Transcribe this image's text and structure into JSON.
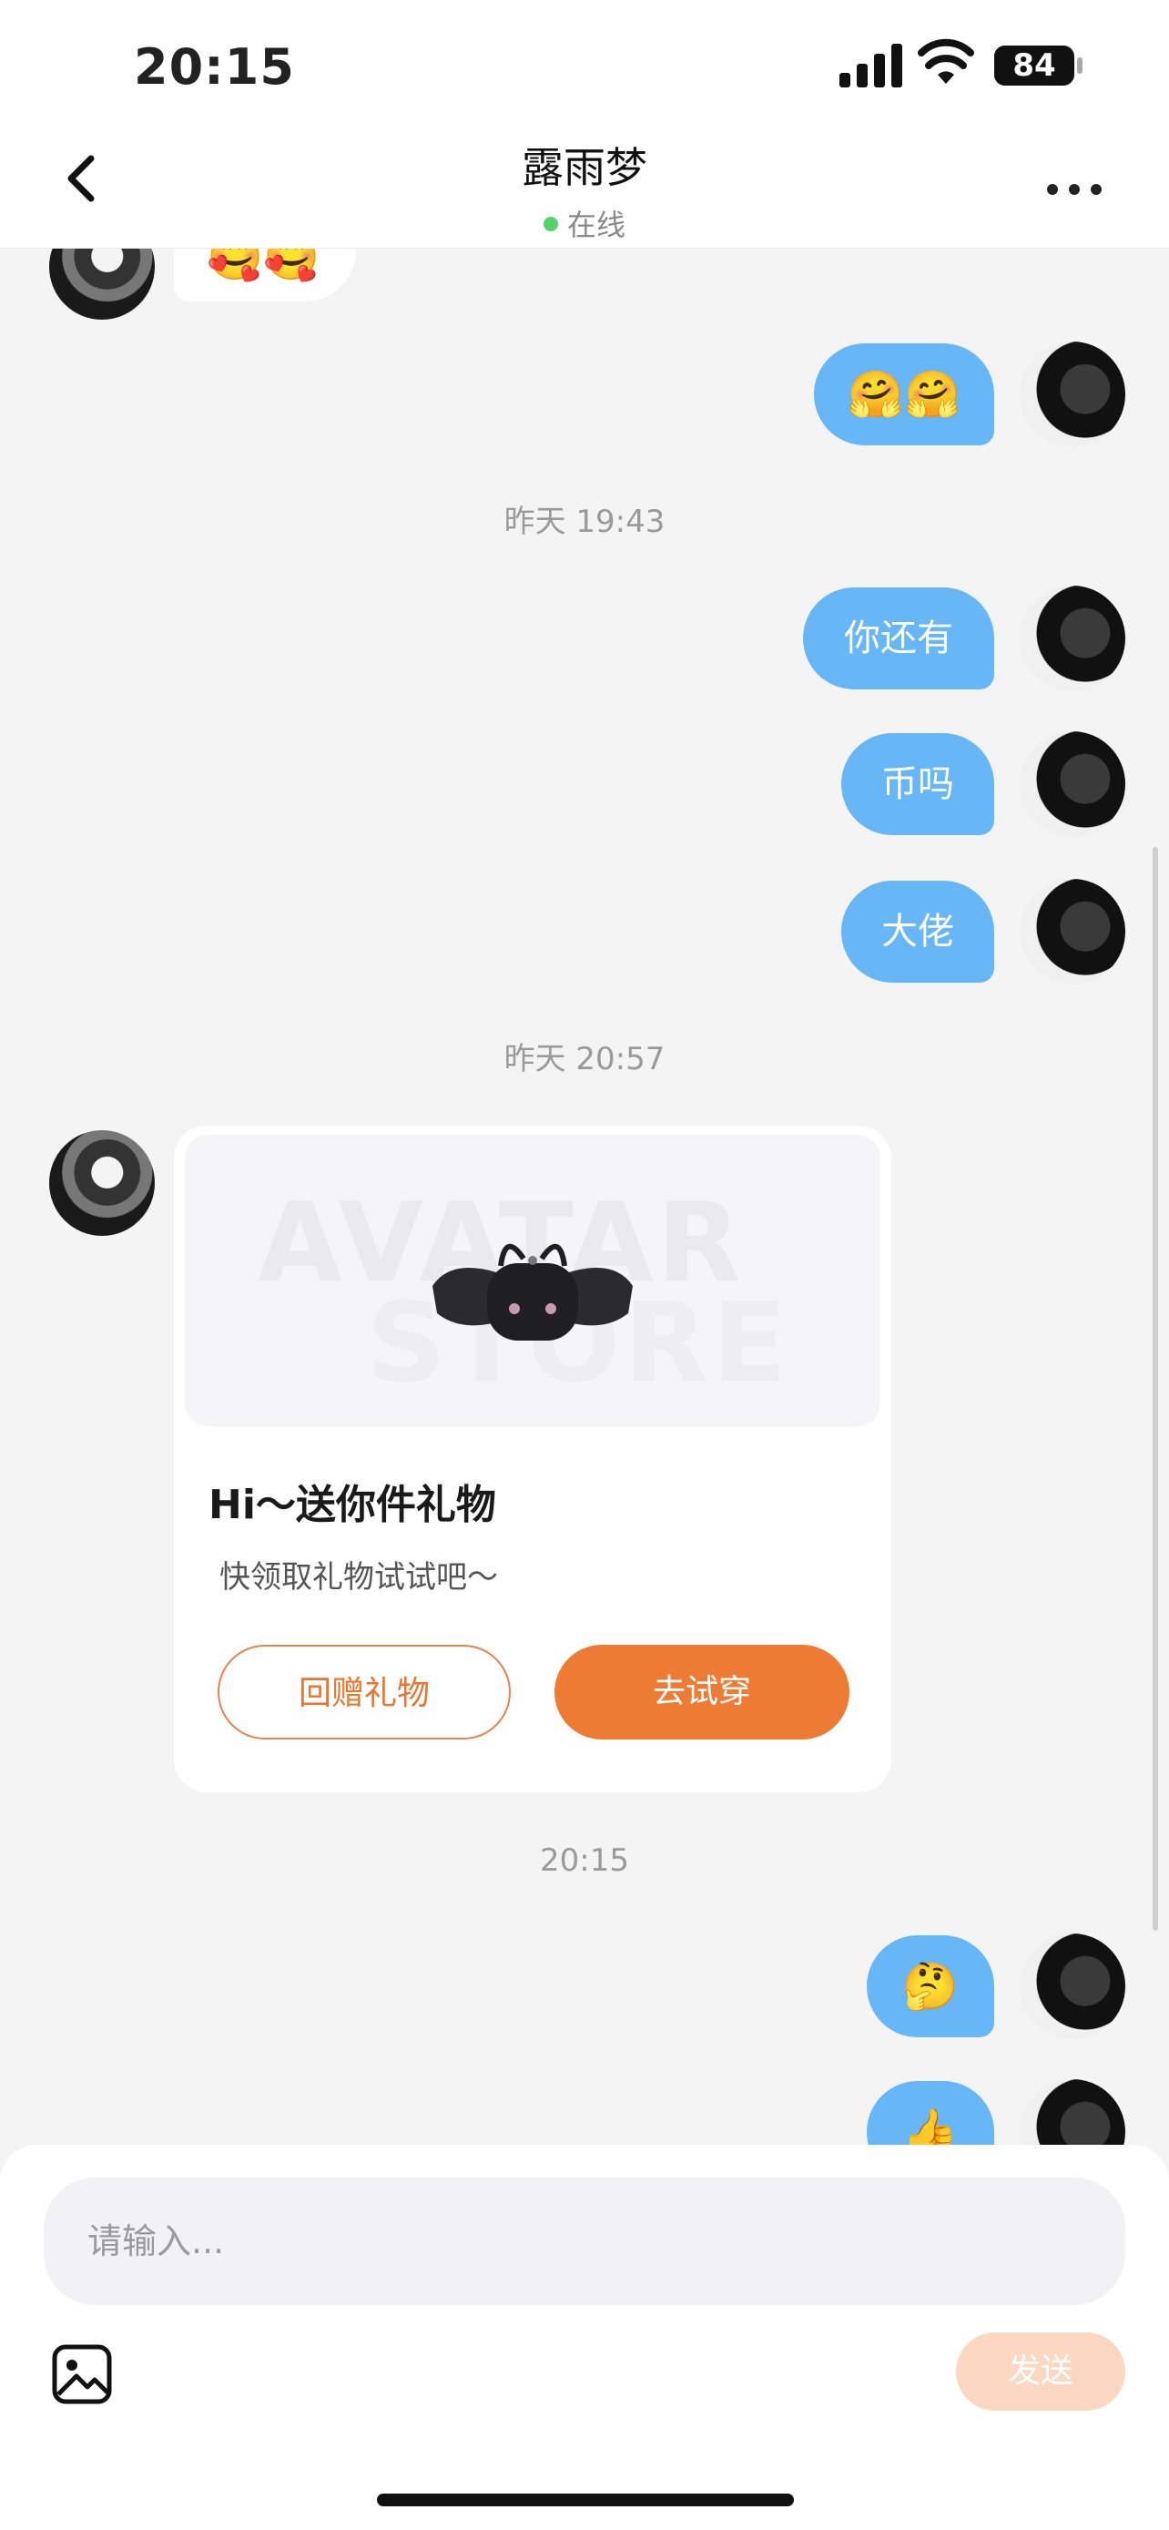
{
  "status_bar": {
    "time": "20:15",
    "battery": "84",
    "battery_level": 0.84
  },
  "header": {
    "title": "露雨梦",
    "status": "在线"
  },
  "messages": {
    "msg_top_in_emoji": "🥰🥰",
    "msg_hug": "🤗🤗",
    "timestamp_1": "昨天 19:43",
    "msg_1": "你还有",
    "msg_2": "币吗",
    "msg_3": "大佬",
    "timestamp_2": "昨天 20:57",
    "timestamp_3": "20:15",
    "msg_thinking": "🤔",
    "msg_thumbs": "👍"
  },
  "gift_card": {
    "watermark_line1": "AVATAR",
    "watermark_line2": "STORE",
    "title": "Hi～送你件礼物",
    "subtitle": "快领取礼物试试吧～",
    "return_gift_label": "回赠礼物",
    "try_on_label": "去试穿"
  },
  "composer": {
    "placeholder": "请输入...",
    "send_label": "发送"
  },
  "colors": {
    "outgoing_bubble": "#67b6f5",
    "accent": "#ee7b34",
    "online": "#55d36a",
    "send_disabled": "#fbd8c2"
  },
  "icons": [
    "back-icon",
    "more-icon",
    "image-icon",
    "signal-icon",
    "wifi-icon",
    "battery-icon"
  ]
}
